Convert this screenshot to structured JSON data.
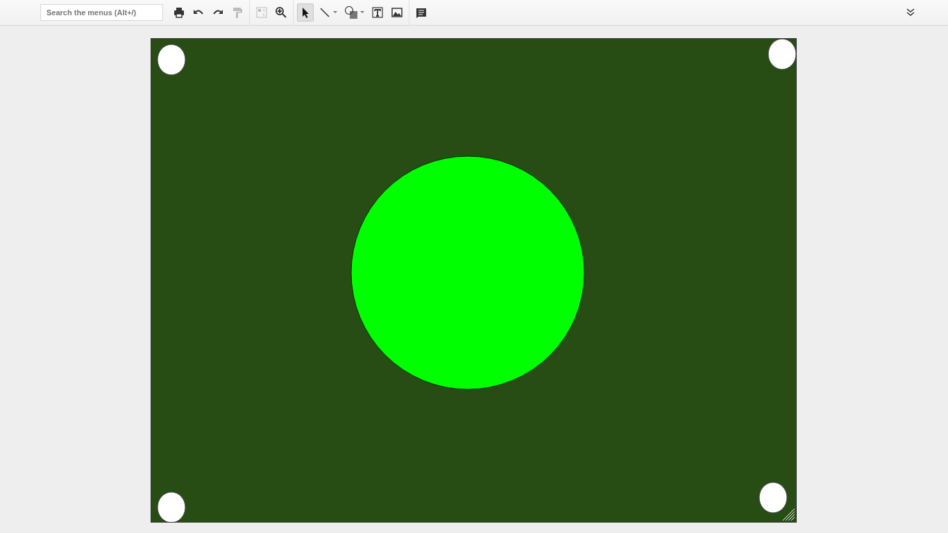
{
  "toolbar": {
    "search": {
      "placeholder": "Search the menus (Alt+/)"
    },
    "groups": [
      [
        {
          "kind": "print",
          "selected": false,
          "disabled": false
        },
        {
          "kind": "undo",
          "selected": false,
          "disabled": false
        },
        {
          "kind": "redo",
          "selected": false,
          "disabled": false
        },
        {
          "kind": "paint-format",
          "selected": false,
          "disabled": true
        }
      ],
      [
        {
          "kind": "fit",
          "selected": false,
          "disabled": true
        },
        {
          "kind": "zoom",
          "selected": false,
          "disabled": false
        }
      ],
      [
        {
          "kind": "select",
          "selected": true,
          "disabled": false
        },
        {
          "kind": "line",
          "selected": false,
          "disabled": false
        },
        {
          "kind": "shape",
          "selected": false,
          "disabled": false
        },
        {
          "kind": "textbox",
          "selected": false,
          "disabled": false
        },
        {
          "kind": "image",
          "selected": false,
          "disabled": false
        }
      ],
      [
        {
          "kind": "comment",
          "selected": false,
          "disabled": false
        }
      ]
    ]
  },
  "canvas": {
    "color": "#274d15",
    "shapes": [
      {
        "kind": "corner",
        "color": "#ffffff"
      },
      {
        "kind": "corner",
        "color": "#ffffff"
      },
      {
        "kind": "circle",
        "color": "#00ff00"
      },
      {
        "kind": "corner",
        "color": "#ffffff"
      },
      {
        "kind": "corner",
        "color": "#ffffff"
      }
    ]
  }
}
